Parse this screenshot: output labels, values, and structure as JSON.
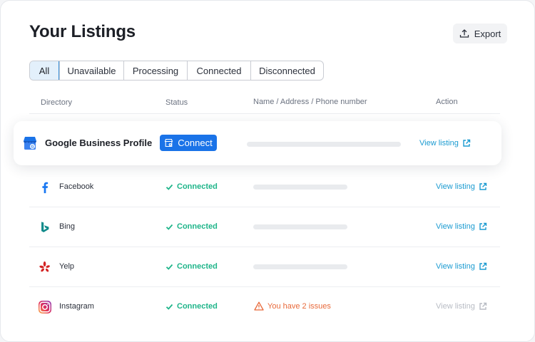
{
  "page": {
    "title": "Your Listings",
    "export_label": "Export"
  },
  "tabs": [
    "All",
    "Unavailable",
    "Processing",
    "Connected",
    "Disconnected"
  ],
  "active_tab": "All",
  "columns": [
    "Directory",
    "Status",
    "Name / Address / Phone number",
    "Action"
  ],
  "featured": {
    "name": "Google Business Profile",
    "connect_label": "Connect",
    "action_label": "View listing"
  },
  "rows": [
    {
      "name": "Facebook",
      "icon": "facebook-icon",
      "status": "Connected",
      "action": "View listing"
    },
    {
      "name": "Bing",
      "icon": "bing-icon",
      "status": "Connected",
      "action": "View listing"
    },
    {
      "name": "Yelp",
      "icon": "yelp-icon",
      "status": "Connected",
      "action": "View listing"
    },
    {
      "name": "Instagram",
      "icon": "instagram-icon",
      "status": "Connected",
      "issue": "You have 2 issues",
      "action": "View listing",
      "action_disabled": true
    }
  ],
  "colors": {
    "accent": "#1a73e8",
    "connected": "#1fb58a",
    "link": "#1b9bd1",
    "warning": "#e8693a",
    "tab_active_bg": "#e3f0fb"
  }
}
